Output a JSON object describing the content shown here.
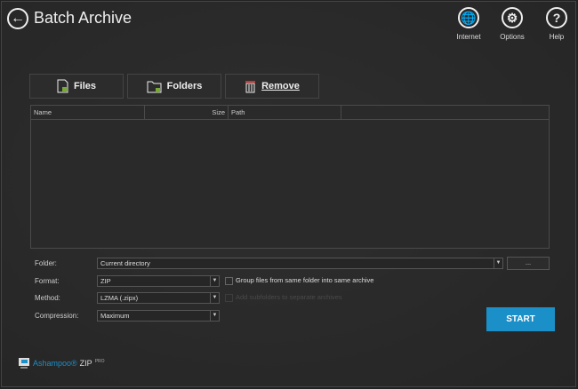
{
  "header": {
    "title": "Batch Archive",
    "buttons": [
      {
        "label": "Internet",
        "icon": "globe-icon"
      },
      {
        "label": "Options",
        "icon": "gear-icon"
      },
      {
        "label": "Help",
        "icon": "help-icon"
      }
    ]
  },
  "toolbar": {
    "files": "Files",
    "folders": "Folders",
    "remove": "Remove"
  },
  "table": {
    "columns": [
      "Name",
      "Size",
      "Path",
      ""
    ],
    "rows": []
  },
  "form": {
    "folder": {
      "label": "Folder:",
      "value": "Current directory",
      "browse": "..."
    },
    "format": {
      "label": "Format:",
      "value": "ZIP"
    },
    "method": {
      "label": "Method:",
      "value": "LZMA (.zipx)"
    },
    "compression": {
      "label": "Compression:",
      "value": "Maximum"
    },
    "group_files": {
      "label": "Group files from same folder into same archive",
      "checked": false
    },
    "subfolders": {
      "label": "Add subfolders to separate archives",
      "checked": false,
      "disabled": true
    }
  },
  "start": "START",
  "brand": {
    "name": "Ashampoo®",
    "product": "ZIP",
    "edition": "PRO"
  },
  "colors": {
    "accent": "#1b8fc7"
  }
}
